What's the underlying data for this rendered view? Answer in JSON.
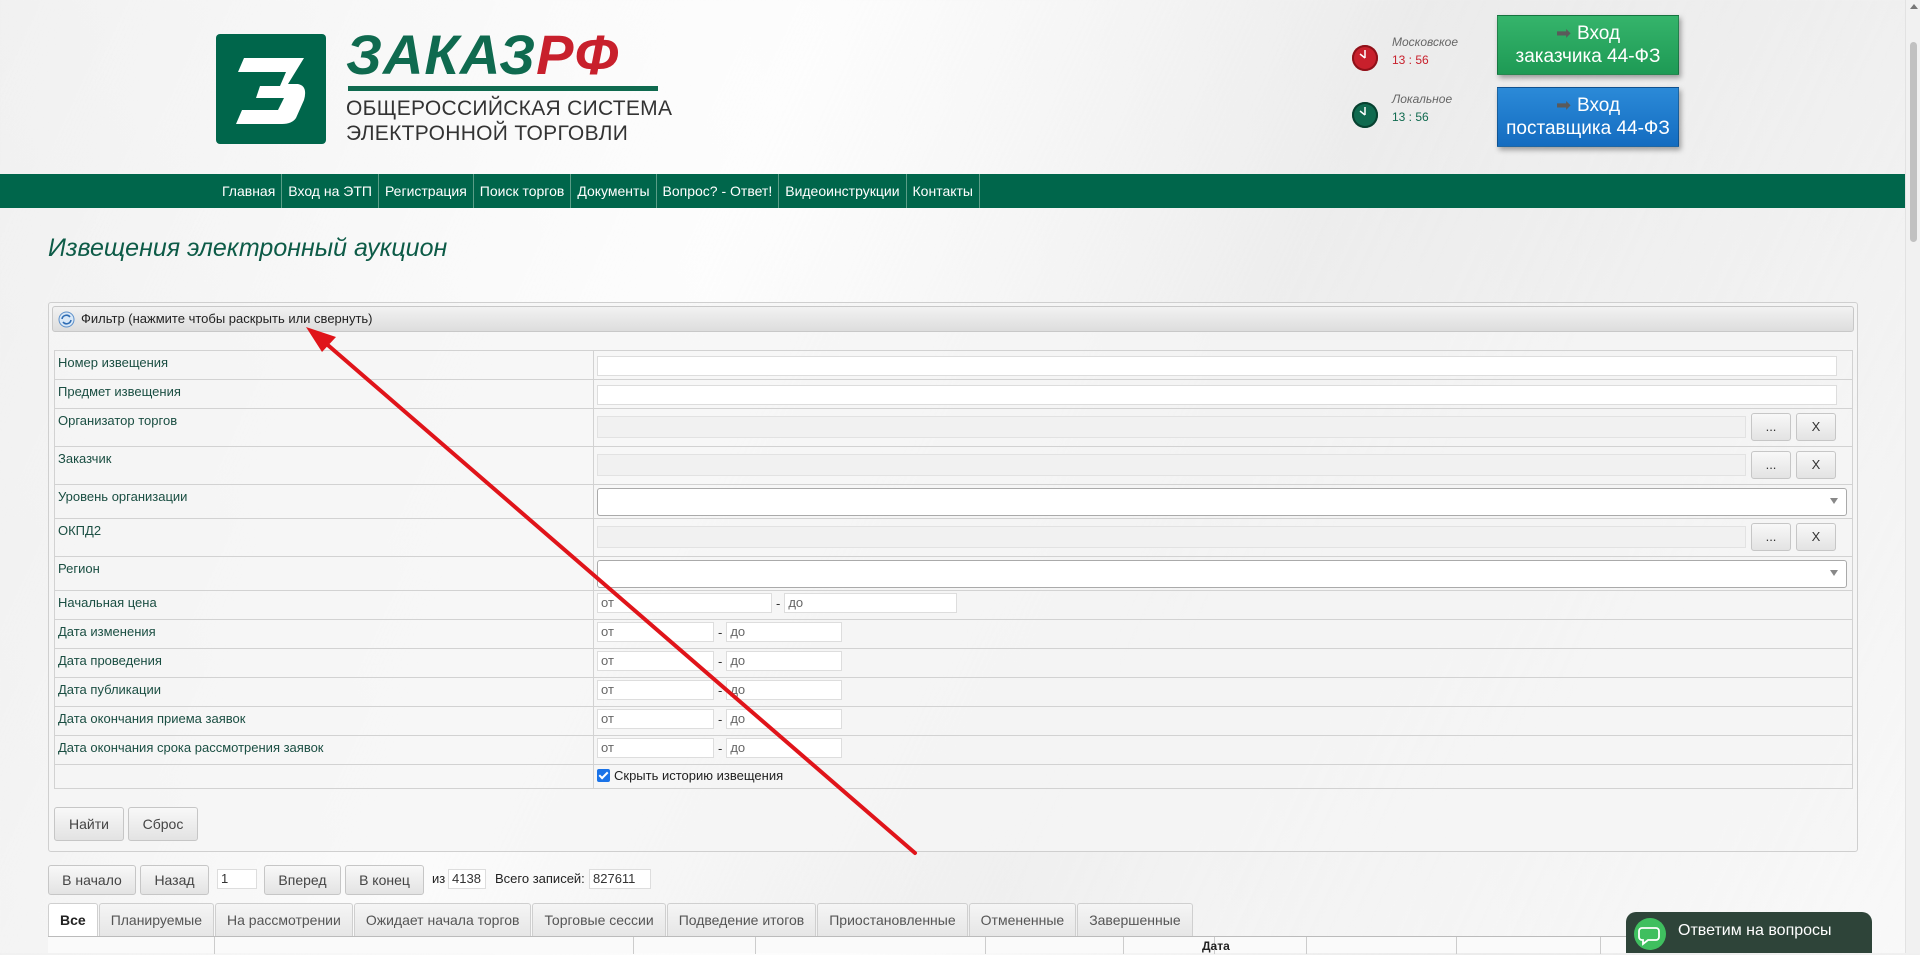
{
  "brand": {
    "name_green": "ЗАКАЗ",
    "name_red": "РФ",
    "subtitle_line1": "ОБЩЕРОССИЙСКАЯ СИСТЕМА",
    "subtitle_line2": "ЭЛЕКТРОННОЙ ТОРГОВЛИ",
    "logo_letter": "З"
  },
  "clocks": {
    "moscow": {
      "label": "Московское",
      "time": "13 : 56"
    },
    "local": {
      "label": "Локальное",
      "time": "13 : 56"
    }
  },
  "login": {
    "customer_line1": "Вход",
    "customer_line2": "заказчика 44-ФЗ",
    "supplier_line1": "Вход",
    "supplier_line2": "поставщика 44-ФЗ"
  },
  "nav": {
    "items": [
      {
        "label": "Главная"
      },
      {
        "label": "Вход на ЭТП"
      },
      {
        "label": "Регистрация"
      },
      {
        "label": "Поиск торгов"
      },
      {
        "label": "Документы"
      },
      {
        "label": "Вопрос? - Ответ!"
      },
      {
        "label": "Видеоинструкции"
      },
      {
        "label": "Контакты"
      }
    ]
  },
  "page": {
    "title": "Извещения электронный аукцион"
  },
  "filter": {
    "header": "Фильтр (нажмите чтобы раскрыть или свернуть)",
    "labels": {
      "notice_number": "Номер извещения",
      "notice_subject": "Предмет извещения",
      "organizer": "Организатор торгов",
      "customer": "Заказчик",
      "org_level": "Уровень организации",
      "okpd2": "ОКПД2",
      "region": "Регион",
      "start_price": "Начальная цена",
      "date_changed": "Дата изменения",
      "date_held": "Дата проведения",
      "date_published": "Дата публикации",
      "date_bids_end": "Дата окончания приема заявок",
      "date_review_end": "Дата окончания срока рассмотрения заявок"
    },
    "from_placeholder": "от",
    "to_placeholder": "до",
    "dash": "-",
    "pick_label": "...",
    "clear_label": "X",
    "hide_history_label": "Скрыть историю извещения",
    "find_label": "Найти",
    "reset_label": "Сброс"
  },
  "pager": {
    "first": "В начало",
    "prev": "Назад",
    "page": "1",
    "next": "Вперед",
    "last": "В конец",
    "of_label": "из",
    "total_pages": "4138",
    "records_label": "Всего записей:",
    "total_records": "827611"
  },
  "tabs": [
    {
      "label": "Все",
      "active": true
    },
    {
      "label": "Планируемые"
    },
    {
      "label": "На рассмотрении"
    },
    {
      "label": "Ожидает начала торгов"
    },
    {
      "label": "Торговые сессии"
    },
    {
      "label": "Подведение итогов"
    },
    {
      "label": "Приостановленные"
    },
    {
      "label": "Отмененные"
    },
    {
      "label": "Завершенные"
    }
  ],
  "grid": {
    "visible_header": "Дата"
  },
  "chat": {
    "label": "Ответим на вопросы"
  },
  "colors": {
    "brand_green": "#00664b",
    "brand_red": "#c8202c",
    "customer_button": "#1e9a55",
    "supplier_button": "#146cc0",
    "annotation_arrow": "#e0141a"
  }
}
